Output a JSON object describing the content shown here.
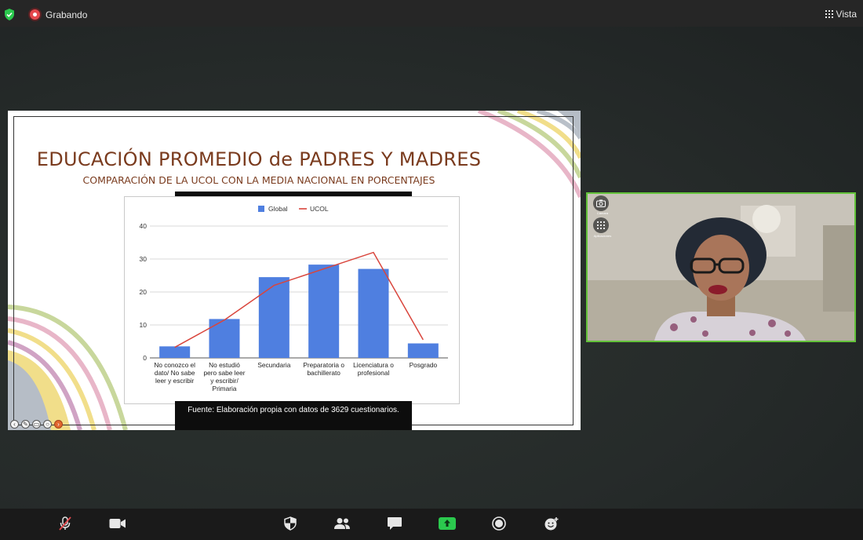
{
  "app": {
    "recording_label": "Grabando",
    "view_label": "Vista",
    "colors": {
      "recording": "#e5484d",
      "active_speaker": "#63c23a",
      "share_green": "#2bc94e",
      "slide_brown": "#7a3b1e"
    }
  },
  "slide": {
    "title": "EDUCACIÓN PROMEDIO de PADRES Y MADRES",
    "subtitle": "COMPARACIÓN DE LA UCOL CON LA MEDIA NACIONAL EN PORCENTAJES",
    "caption": "Fuente: Elaboración propia con datos de 3629 cuestionarios."
  },
  "chart_data": {
    "type": "bar",
    "categories": [
      [
        "No conozco el",
        "dato/ No sabe",
        "leer y escribir"
      ],
      [
        "No estudió",
        "pero sabe leer",
        "y escribir/",
        "Primaria"
      ],
      [
        "Secundaria"
      ],
      [
        "Preparatoria o",
        "bachillerato"
      ],
      [
        "Licenciatura o",
        "profesional"
      ],
      [
        "Posgrado"
      ]
    ],
    "series": [
      {
        "name": "Global",
        "kind": "bar",
        "color": "#4f7fe0",
        "values": [
          3.5,
          11.8,
          24.5,
          28.3,
          27.0,
          4.4
        ]
      },
      {
        "name": "UCOL",
        "kind": "line",
        "color": "#d9453c",
        "values": [
          3.2,
          11.5,
          22.0,
          27.0,
          32.0,
          5.5
        ]
      }
    ],
    "yticks": [
      "0",
      "10",
      "20",
      "30",
      "40"
    ],
    "ylim": [
      0,
      40
    ],
    "legend": "top-center",
    "grid": true
  },
  "video": {
    "camera_label": "Cámara",
    "apps_label": "Aplicaciones"
  },
  "toolbar": {
    "items": [
      "mic-muted-icon",
      "video-icon",
      "security-icon",
      "participants-icon",
      "chat-icon",
      "share-screen-icon",
      "record-icon",
      "reactions-icon"
    ]
  }
}
